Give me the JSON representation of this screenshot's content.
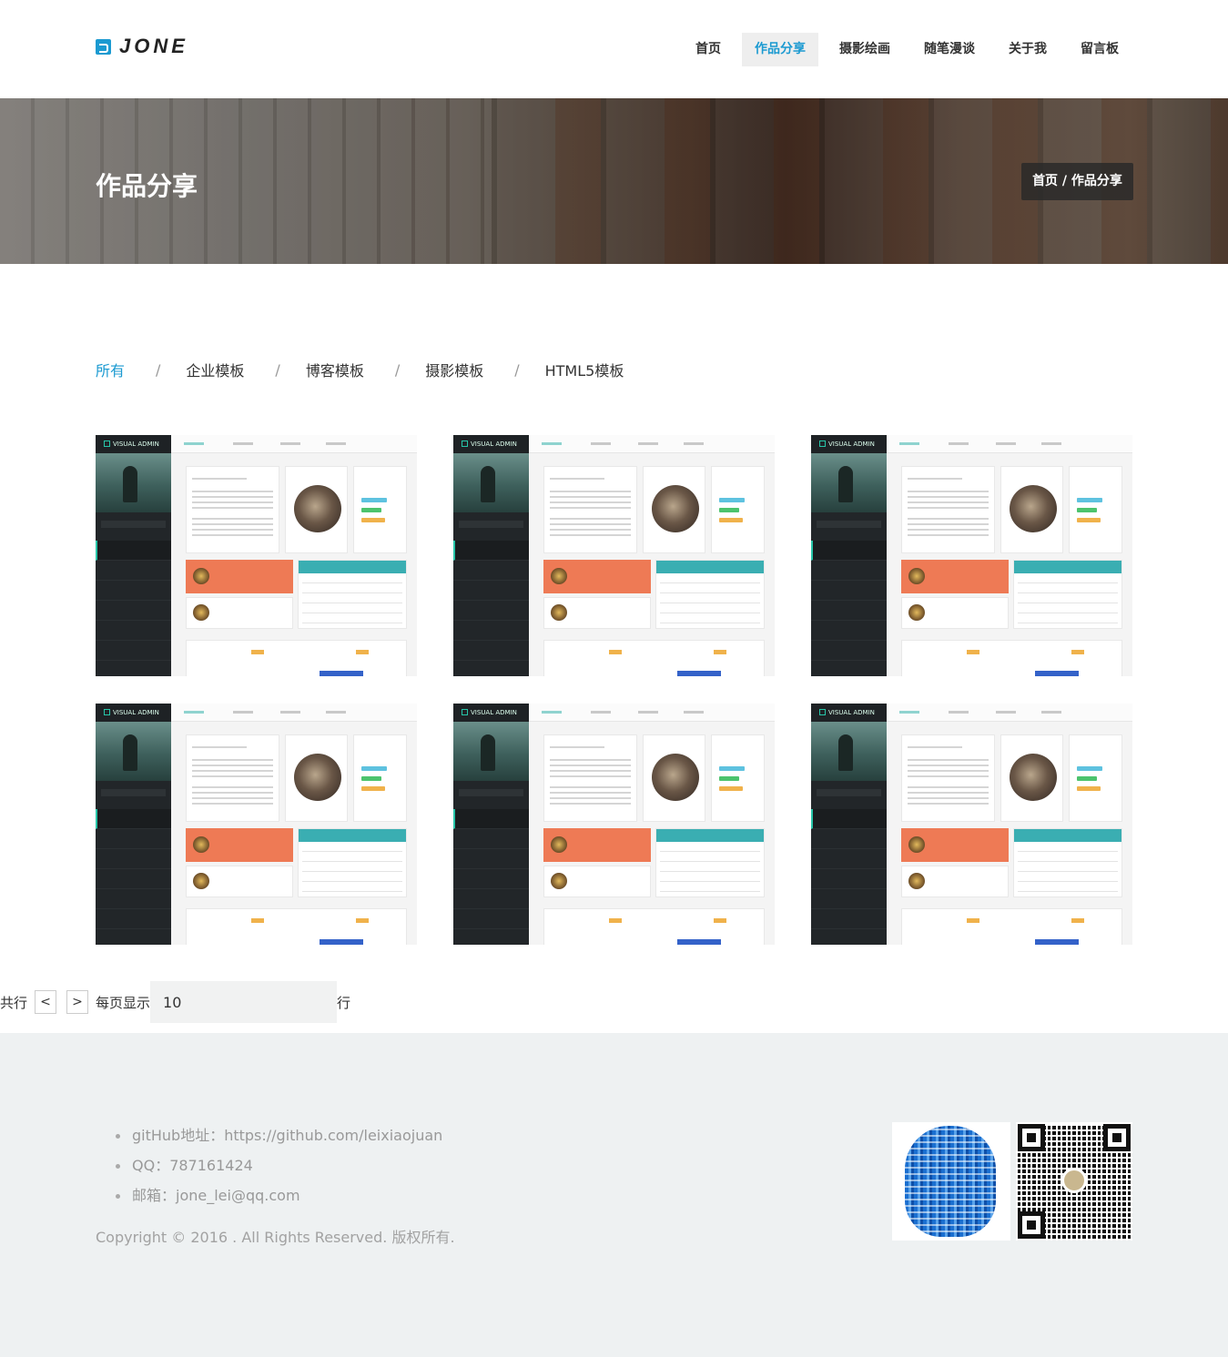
{
  "header": {
    "logo_text": "JONE",
    "nav": [
      {
        "label": "首页",
        "active": false
      },
      {
        "label": "作品分享",
        "active": true
      },
      {
        "label": "摄影绘画",
        "active": false
      },
      {
        "label": "随笔漫谈",
        "active": false
      },
      {
        "label": "关于我",
        "active": false
      },
      {
        "label": "留言板",
        "active": false
      }
    ]
  },
  "banner": {
    "title": "作品分享",
    "breadcrumb": "首页 / 作品分享"
  },
  "filters": {
    "items": [
      "所有",
      "企业模板",
      "博客模板",
      "摄影模板",
      "HTML5模板"
    ],
    "separator": "/",
    "active_index": 0
  },
  "portfolio": {
    "cards": [
      {
        "brand": "VISUAL ADMIN"
      },
      {
        "brand": "VISUAL ADMIN"
      },
      {
        "brand": "VISUAL ADMIN"
      },
      {
        "brand": "VISUAL ADMIN"
      },
      {
        "brand": "VISUAL ADMIN"
      },
      {
        "brand": "VISUAL ADMIN"
      }
    ],
    "colors": {
      "sidebar": "#222629",
      "accent_teal": "#3aaeb2",
      "accent_orange": "#ee7a55",
      "accent_blue": "#3462c9"
    }
  },
  "pager": {
    "total_label": "共行",
    "prev_label": "<",
    "next_label": ">",
    "per_page_label": "每页显示",
    "per_page_value": "10",
    "suffix": "行"
  },
  "footer": {
    "contacts": [
      "gitHub地址：https://github.com/leixiaojuan",
      "QQ：787161424",
      "邮箱：jone_lei@qq.com"
    ],
    "copyright": "Copyright © 2016 . All Rights Reserved. 版权所有.",
    "qr_codes": [
      "qq-qr-icon",
      "wechat-qr-icon"
    ]
  },
  "colors": {
    "brand_blue": "#1b9ad1",
    "footer_bg": "#eef1f2"
  }
}
